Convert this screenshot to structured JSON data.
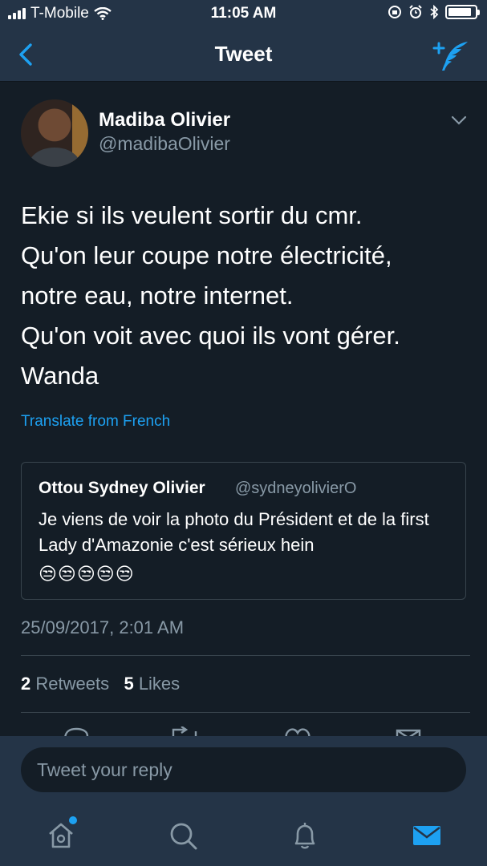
{
  "status_bar": {
    "carrier": "T-Mobile",
    "time": "11:05 AM",
    "icons": [
      "signal-icon",
      "wifi-icon",
      "rotation-lock-icon",
      "alarm-icon",
      "bluetooth-icon",
      "battery-icon"
    ],
    "battery_level": 0.75
  },
  "nav": {
    "title": "Tweet",
    "back_icon": "chevron-left-icon",
    "compose_icon": "compose-tweet-icon"
  },
  "tweet": {
    "author_name": "Madiba Olivier",
    "author_handle": "@madibaOlivier",
    "lines": [
      "Ekie si ils veulent sortir du cmr.",
      "Qu'on leur coupe notre électricité,",
      "notre eau, notre internet.",
      "Qu'on voit avec quoi ils vont gérer.",
      "Wanda"
    ],
    "translate_link": "Translate from French",
    "timestamp": "25/09/2017, 2:01 AM",
    "retweets_count": "2",
    "retweets_label": "Retweets",
    "likes_count": "5",
    "likes_label": "Likes"
  },
  "quoted_tweet": {
    "name": "Ottou Sydney Olivier",
    "handle": "@sydneyolivierO",
    "text": "Je viens de voir la photo du Président et de la first Lady d'Amazonie c'est sérieux hein",
    "emojis": "😒😒😒😒😒"
  },
  "reply": {
    "placeholder": "Tweet your reply"
  },
  "tab_bar": {
    "tabs": [
      "home-icon",
      "search-icon",
      "notifications-icon",
      "messages-icon"
    ],
    "active": "messages-icon"
  },
  "colors": {
    "background": "#141d26",
    "bar": "#243447",
    "accent": "#1da1f2",
    "secondary_text": "#8899a6",
    "border": "#38444d"
  }
}
